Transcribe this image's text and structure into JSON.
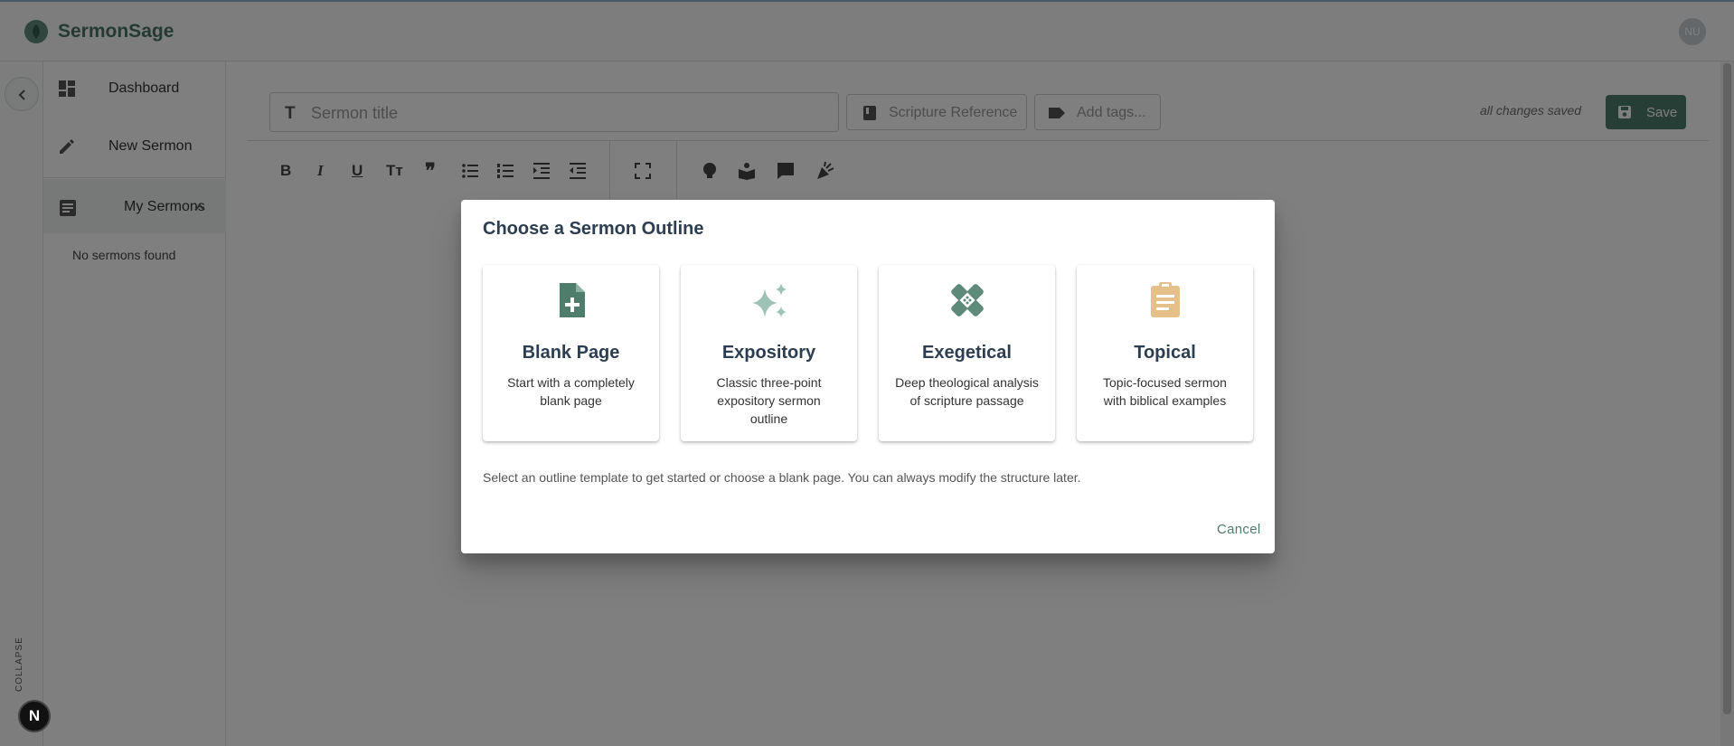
{
  "app": {
    "brand": "SermonSage",
    "avatar_initials": "NU",
    "accent": "#4e7d6c"
  },
  "rail": {
    "collapse_label": "COLLAPSE",
    "next_badge": "N"
  },
  "sidebar": {
    "items": [
      {
        "label": "Dashboard",
        "icon": "dashboard-icon"
      },
      {
        "label": "New Sermon",
        "icon": "pencil-icon"
      },
      {
        "label": "My Sermons",
        "icon": "document-icon"
      }
    ],
    "empty_text": "No sermons found"
  },
  "editor": {
    "title_placeholder": "Sermon title",
    "scripture_placeholder": "Scripture Reference",
    "tags_placeholder": "Add tags...",
    "saved_status": "all changes saved",
    "save_label": "Save",
    "toolbar_icons": [
      "bold-icon",
      "italic-icon",
      "underline-icon",
      "text-size-icon",
      "quote-icon",
      "bullet-list-icon",
      "numbered-list-icon",
      "indent-icon",
      "outdent-icon",
      "fullscreen-icon",
      "lightbulb-icon",
      "reader-icon",
      "comment-icon",
      "celebration-icon"
    ]
  },
  "dialog": {
    "title": "Choose a Sermon Outline",
    "cards": [
      {
        "name": "Blank Page",
        "description": "Start with a completely blank page",
        "icon": "note-add-icon",
        "color": "#4e7d6c"
      },
      {
        "name": "Expository",
        "description": "Classic three-point expository sermon outline",
        "icon": "sparkle-icon",
        "color": "#9ec2b6"
      },
      {
        "name": "Exegetical",
        "description": "Deep theological analysis of scripture passage",
        "icon": "bandage-icon",
        "color": "#5e8a7a"
      },
      {
        "name": "Topical",
        "description": "Topic-focused sermon with biblical examples",
        "icon": "clipboard-icon",
        "color": "#e6c08a"
      }
    ],
    "help_text": "Select an outline template to get started or choose a blank page. You can always modify the structure later.",
    "cancel_label": "Cancel"
  }
}
